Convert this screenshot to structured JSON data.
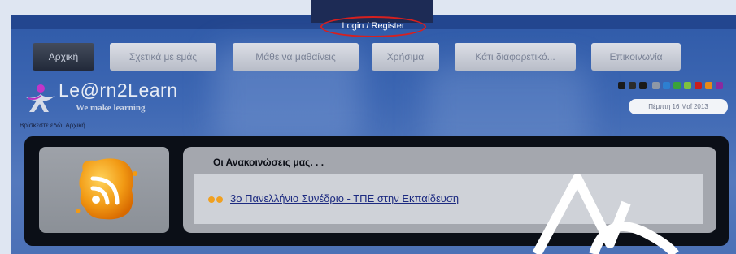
{
  "header": {
    "login_label": "Login / Register"
  },
  "nav": {
    "tabs": [
      {
        "label": "Αρχική",
        "active": true
      },
      {
        "label": "Σχετικά με εμάς",
        "active": false
      },
      {
        "label": "Μάθε να μαθαίνεις",
        "active": false
      },
      {
        "label": "Χρήσιμα",
        "active": false
      },
      {
        "label": "Κάτι διαφορετικό...",
        "active": false
      },
      {
        "label": "Επικοινωνία",
        "active": false
      }
    ]
  },
  "branding": {
    "logo_text": "Le@rn2Learn",
    "tagline": "We make learning"
  },
  "breadcrumb": "Βρίσκεστε εδώ: Αρχική",
  "style_swatches": [
    "#1a1a1a",
    "#2b2b2b",
    "#1a1a1a",
    "#8e98a6",
    "#2d7fd0",
    "#3aa23a",
    "#7fc23d",
    "#c81e1e",
    "#e88a18",
    "#8a2aa0"
  ],
  "date": "Πέμπτη 16 Μαΐ 2013",
  "announcements": {
    "heading": "Οι Ανακοινώσεις μας. . .",
    "items": [
      {
        "text": "3ο Πανελλήνιο Συνέδριο - ΤΠΕ στην Εκπαίδευση"
      }
    ]
  },
  "colors": {
    "highlight_oval": "#d6201f",
    "page_blue": "#3d67b3",
    "link": "#1c2a80"
  }
}
